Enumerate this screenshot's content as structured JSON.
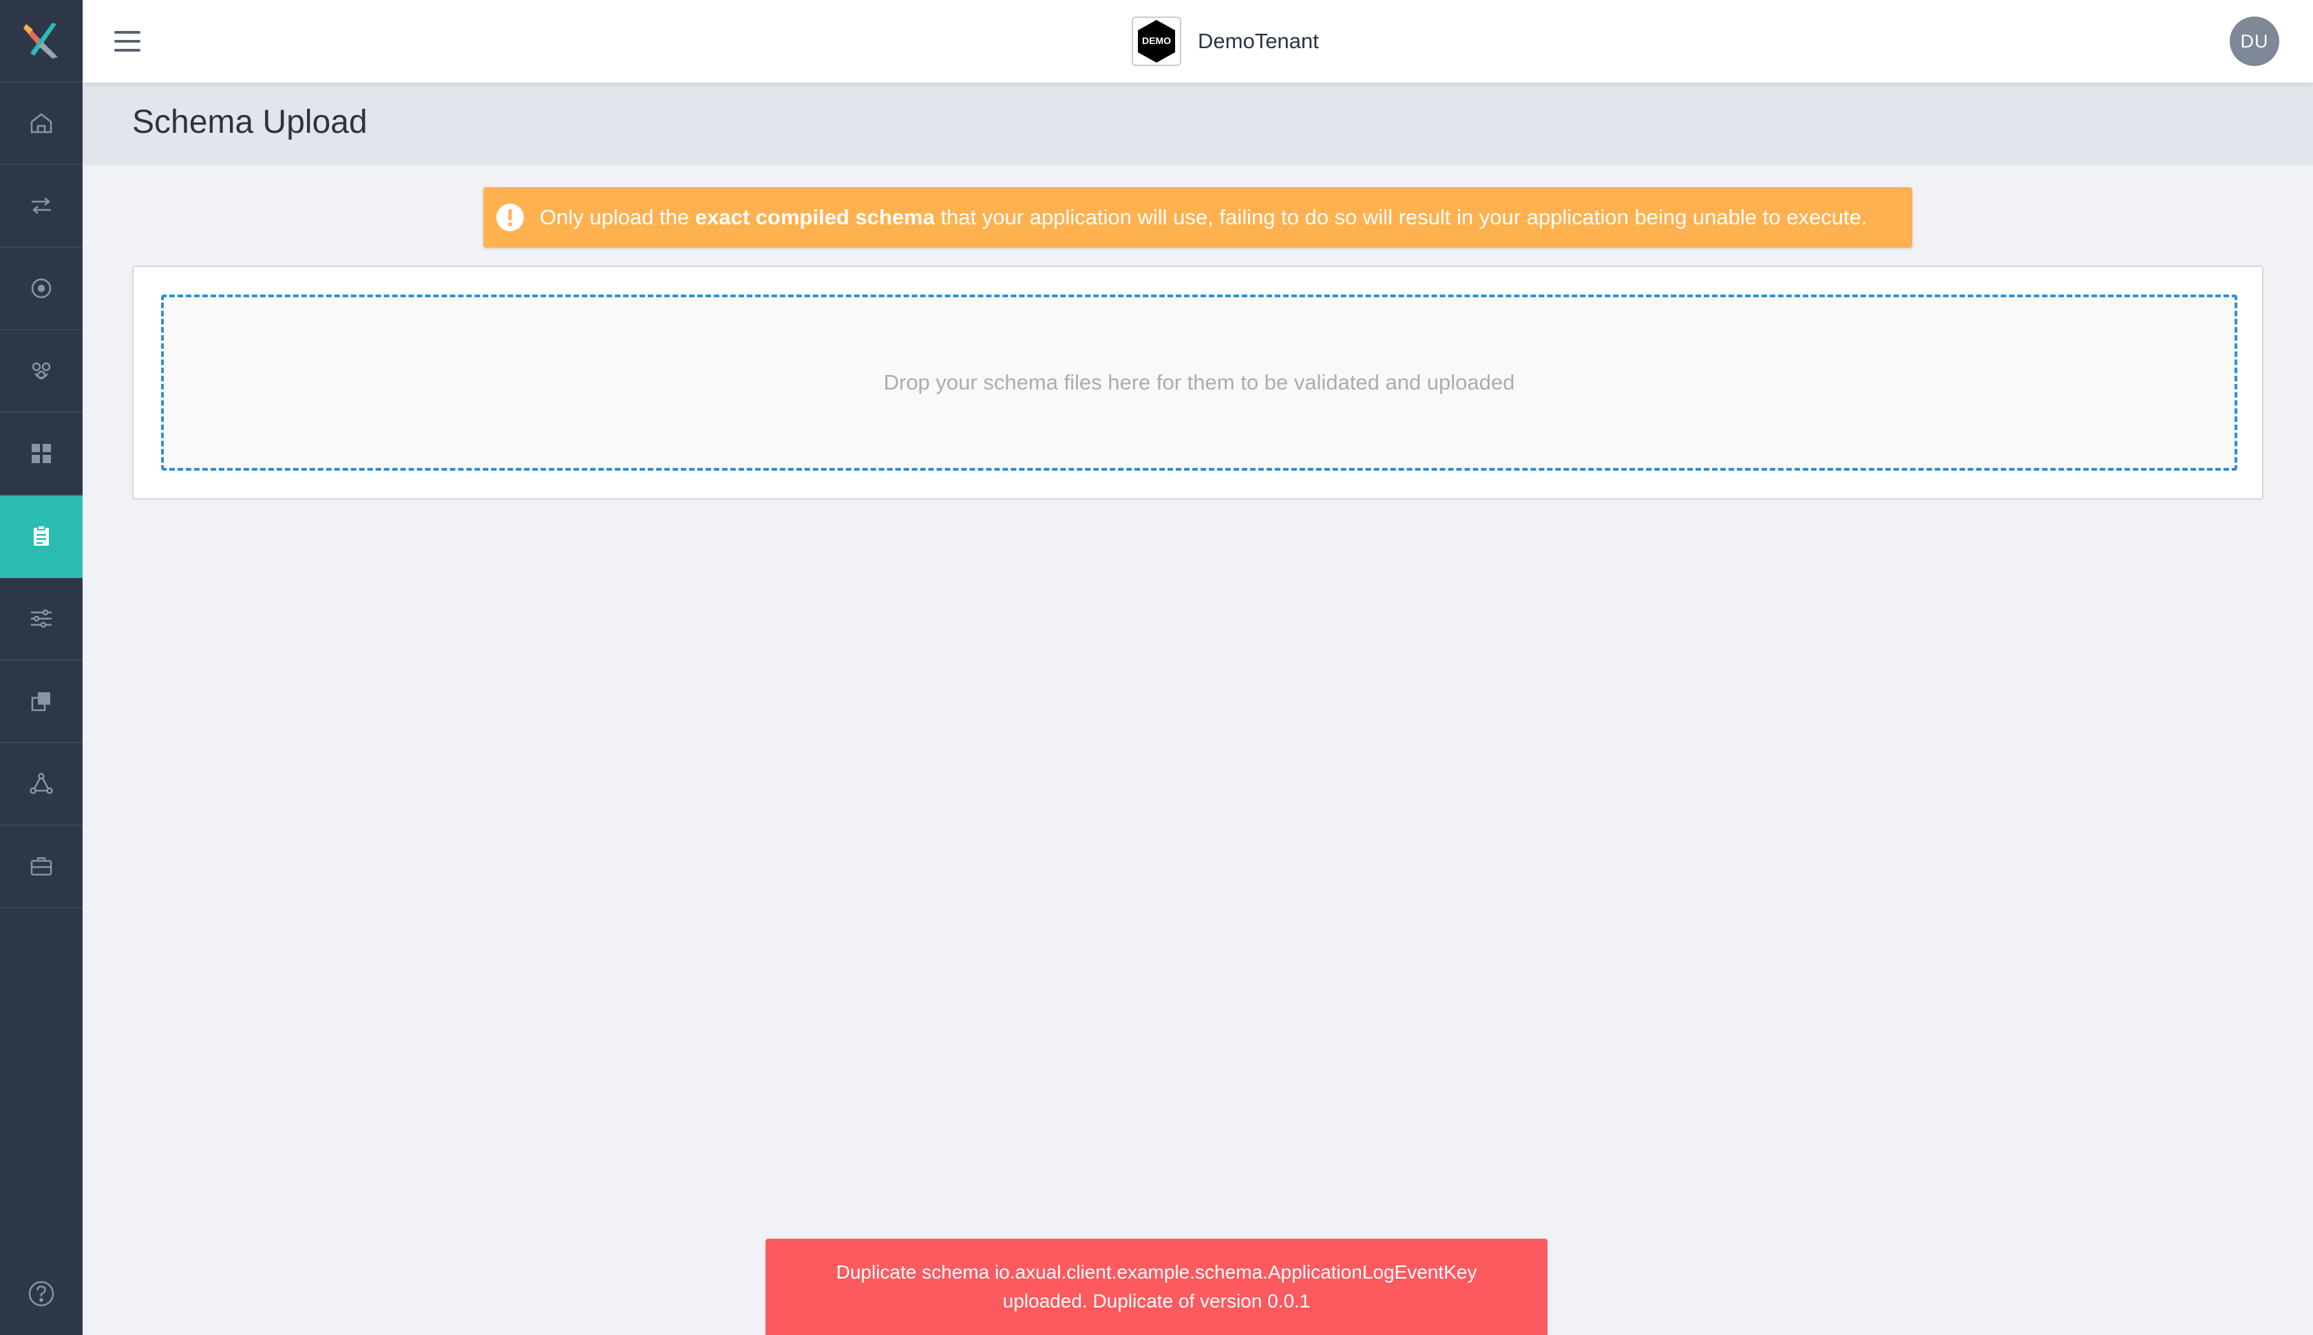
{
  "sidebar": {
    "items": [
      {
        "name": "home-icon"
      },
      {
        "name": "streams-icon"
      },
      {
        "name": "target-icon"
      },
      {
        "name": "collaboration-icon"
      },
      {
        "name": "dashboard-icon"
      },
      {
        "name": "schema-clipboard-icon",
        "active": true
      },
      {
        "name": "sliders-icon"
      },
      {
        "name": "copy-icon"
      },
      {
        "name": "network-icon"
      },
      {
        "name": "briefcase-icon"
      }
    ],
    "help_icon": "help-icon",
    "active_color": "#2bbcb1",
    "background": "#2d3748"
  },
  "topbar": {
    "tenant_logo_text": "DEMO",
    "tenant_name": "DemoTenant",
    "avatar_initials": "DU"
  },
  "page": {
    "title": "Schema Upload"
  },
  "alert": {
    "text_before": "Only upload the ",
    "text_bold": "exact compiled schema",
    "text_after": " that your application will use, failing to do so will result in your application being unable to execute.",
    "color": "#ffb150"
  },
  "dropzone": {
    "text": "Drop your schema files here for them to be validated and uploaded"
  },
  "toast": {
    "message": "Duplicate schema io.axual.client.example.schema.ApplicationLogEventKey uploaded. Duplicate of version 0.0.1",
    "color": "#fd5a5f"
  }
}
